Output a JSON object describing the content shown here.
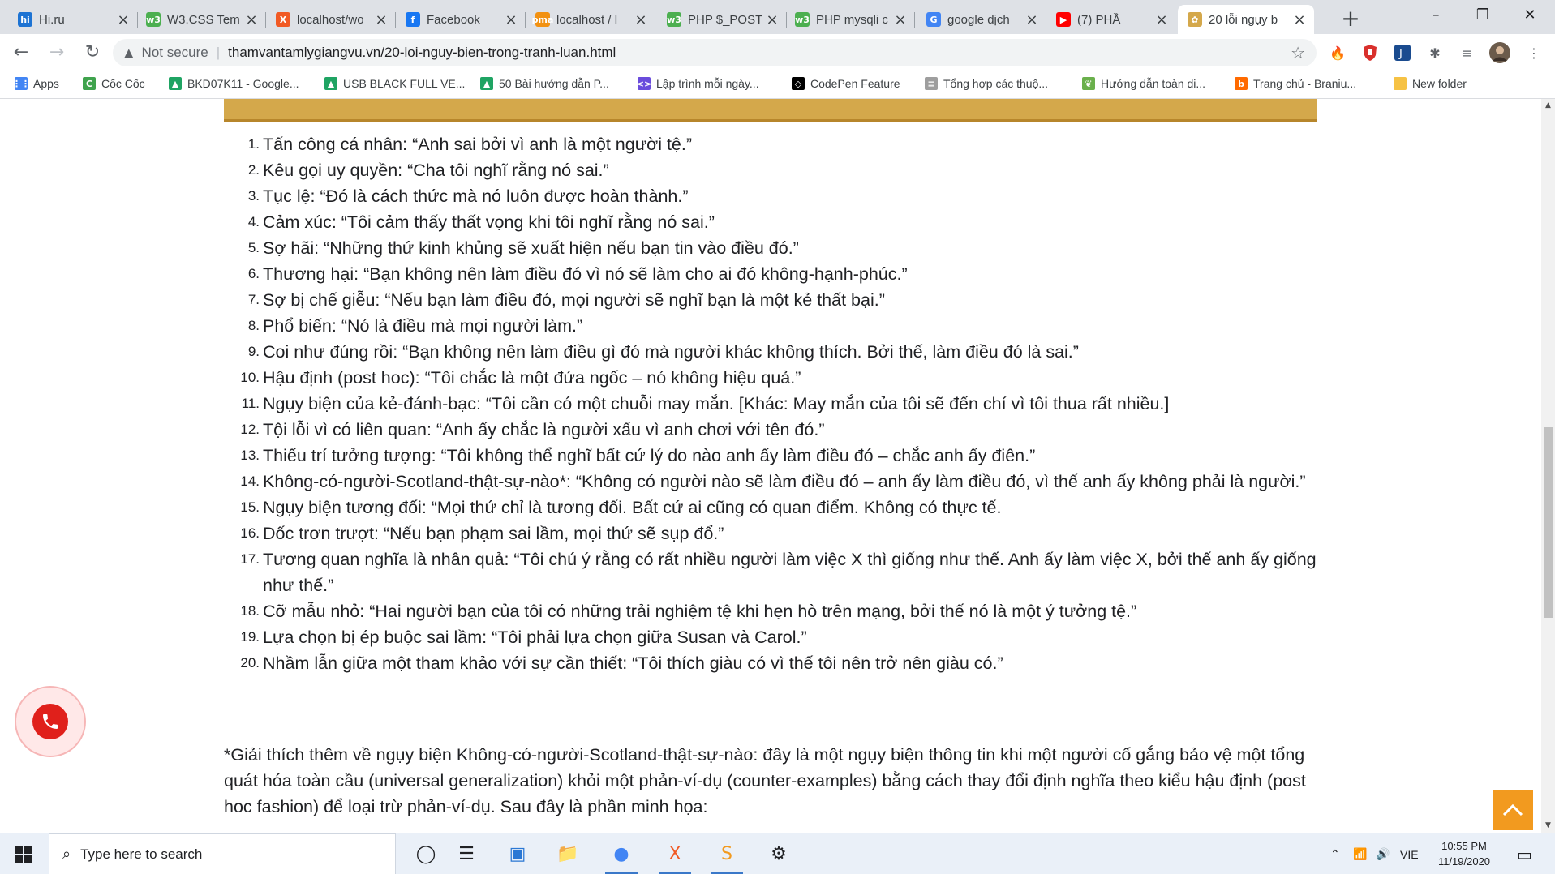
{
  "browser": {
    "tabs": [
      {
        "title": "Hi.ru",
        "icon": "hi-favicon",
        "color": "#1d73d3",
        "glyph": "hi"
      },
      {
        "title": "W3.CSS Tem",
        "icon": "w3schools-favicon",
        "color": "#4caf50",
        "glyph": "w3"
      },
      {
        "title": "localhost/wo",
        "icon": "xampp-favicon",
        "color": "#f15a24",
        "glyph": "X"
      },
      {
        "title": "Facebook",
        "icon": "facebook-favicon",
        "color": "#1877f2",
        "glyph": "f"
      },
      {
        "title": "localhost / l",
        "icon": "phpmyadmin-favicon",
        "color": "#f29111",
        "glyph": "pma"
      },
      {
        "title": "PHP $_POST",
        "icon": "w3schools-favicon",
        "color": "#4caf50",
        "glyph": "w3"
      },
      {
        "title": "PHP mysqli c",
        "icon": "w3schools-favicon",
        "color": "#4caf50",
        "glyph": "w3"
      },
      {
        "title": "google dịch",
        "icon": "google-favicon",
        "color": "#4285f4",
        "glyph": "G"
      },
      {
        "title": "(7) PHẦ",
        "icon": "youtube-favicon",
        "color": "#ff0000",
        "glyph": "▶"
      },
      {
        "title": "20 lỗi ngụy b",
        "icon": "site-favicon",
        "color": "#d4a84b",
        "glyph": "✿"
      }
    ],
    "active_tab": 9,
    "address": {
      "security_label": "Not secure",
      "url": "thamvantamlygiangvu.vn/20-loi-nguy-bien-trong-tranh-luan.html"
    },
    "bookmarks": [
      {
        "label": "Apps",
        "icon": "apps-grid-icon",
        "color": "#4285f4",
        "glyph": "⋮⋮"
      },
      {
        "label": "Cốc Cốc",
        "icon": "coccoc-icon",
        "color": "#3fa34d",
        "glyph": "C"
      },
      {
        "label": "BKD07K11 - Google...",
        "icon": "google-drive-icon",
        "color": "#1fa463",
        "glyph": "▲"
      },
      {
        "label": "USB BLACK FULL VE...",
        "icon": "google-drive-icon",
        "color": "#1fa463",
        "glyph": "▲"
      },
      {
        "label": "50 Bài hướng dẫn P...",
        "icon": "google-drive-icon",
        "color": "#1fa463",
        "glyph": "▲"
      },
      {
        "label": "Lập trình mỗi ngày...",
        "icon": "purple-site-icon",
        "color": "#6a4cdc",
        "glyph": "<>"
      },
      {
        "label": "CodePen Feature",
        "icon": "codepen-icon",
        "color": "#000000",
        "glyph": "◇"
      },
      {
        "label": "Tổng hợp các thuộ...",
        "icon": "doc-icon",
        "color": "#9e9e9e",
        "glyph": "≡"
      },
      {
        "label": "Hướng dẫn toàn di...",
        "icon": "leaf-icon",
        "color": "#6ab04c",
        "glyph": "❦"
      },
      {
        "label": "Trang chủ - Braniu...",
        "icon": "b-site-icon",
        "color": "#ff6a00",
        "glyph": "b"
      },
      {
        "label": "New folder",
        "icon": "folder-icon",
        "color": "#f6c244",
        "glyph": ""
      }
    ]
  },
  "page": {
    "fallacies": [
      {
        "num": "1.",
        "text": "Tấn công cá nhân: “Anh sai bởi vì anh là một người tệ.”"
      },
      {
        "num": "2.",
        "text": "Kêu gọi uy quyền: “Cha tôi nghĩ rằng nó sai.”"
      },
      {
        "num": "3.",
        "text": "Tục lệ: “Đó là cách thức mà nó luôn được hoàn thành.”"
      },
      {
        "num": "4.",
        "text": "Cảm xúc: “Tôi cảm thấy thất vọng khi tôi nghĩ rằng nó sai.”"
      },
      {
        "num": "5.",
        "text": "Sợ hãi: “Những thứ kinh khủng sẽ xuất hiện nếu bạn tin vào điều đó.”"
      },
      {
        "num": "6.",
        "text": "Thương hại: “Bạn không nên làm điều đó vì nó sẽ làm cho ai đó không-hạnh-phúc.”"
      },
      {
        "num": "7.",
        "text": "Sợ bị chế giễu: “Nếu bạn làm điều đó, mọi người sẽ nghĩ bạn là một kẻ thất bại.”"
      },
      {
        "num": "8.",
        "text": "Phổ biến: “Nó là điều mà mọi người làm.”"
      },
      {
        "num": "9.",
        "text": "Coi như đúng rồi: “Bạn không nên làm điều gì đó mà người khác không thích. Bởi thế, làm điều đó là sai.”"
      },
      {
        "num": "10.",
        "text": "Hậu định (post hoc): “Tôi chắc là một đứa ngốc – nó không hiệu quả.”"
      },
      {
        "num": "11.",
        "text": "Ngụy biện của kẻ-đánh-bạc: “Tôi cần có một chuỗi may mắn. [Khác: May mắn của tôi sẽ đến chí vì tôi thua rất nhiều.]"
      },
      {
        "num": "12.",
        "text": "Tội lỗi vì có liên quan: “Anh ấy chắc là người xấu vì anh chơi với tên đó.”"
      },
      {
        "num": "13.",
        "text": "Thiếu trí tưởng tượng: “Tôi không thể nghĩ bất cứ lý do nào anh ấy làm điều đó – chắc anh ấy điên.”"
      },
      {
        "num": "14.",
        "text": "Không-có-người-Scotland-thật-sự-nào*: “Không có người nào sẽ làm điều đó – anh ấy làm điều đó, vì thế anh ấy không phải là người.”"
      },
      {
        "num": "15.",
        "text": "Ngụy biện tương đối: “Mọi thứ chỉ là tương đối. Bất cứ ai cũng có quan điểm. Không có thực tế."
      },
      {
        "num": "16.",
        "text": "Dốc trơn trượt: “Nếu bạn phạm sai lầm, mọi thứ sẽ sụp đổ.”"
      },
      {
        "num": "17.",
        "text": "Tương quan nghĩa là nhân quả: “Tôi chú ý rằng có rất nhiều người làm việc X thì giống như thế. Anh ấy làm việc X, bởi thế anh ấy giống như thế.”"
      },
      {
        "num": "18.",
        "text": "Cỡ mẫu nhỏ: “Hai người bạn của tôi có những trải nghiệm tệ khi hẹn hò trên mạng, bởi thế nó là một ý tưởng tệ.”"
      },
      {
        "num": "19.",
        "text": "Lựa chọn bị ép buộc sai lầm: “Tôi phải lựa chọn giữa Susan và Carol.”"
      },
      {
        "num": "20.",
        "text": "Nhầm lẫn giữa một tham khảo với sự cần thiết: “Tôi thích giàu có vì thế tôi nên trở nên giàu có.”"
      }
    ],
    "note": "*Giải thích thêm về ngụy biện Không-có-người-Scotland-thật-sự-nào: đây là một ngụy biện thông tin khi một người cố gắng bảo vệ một tổng quát hóa toàn cầu (universal generalization) khỏi một phản-ví-dụ (counter-examples) bằng cách thay đổi định nghĩa theo kiểu hậu định (post hoc fashion) để loại trừ phản-ví-dụ. Sau đây là phần minh họa:",
    "accent_color": "#d4a84b",
    "back_to_top_color": "#f29a1f",
    "phone_color": "#e0201b"
  },
  "taskbar": {
    "search_placeholder": "Type here to search",
    "apps": [
      {
        "name": "task-view-icon",
        "glyph": "◯"
      },
      {
        "name": "task-list-icon",
        "glyph": "☰"
      },
      {
        "name": "network-app-icon",
        "glyph": "▣"
      },
      {
        "name": "file-explorer-icon",
        "glyph": "📁"
      },
      {
        "name": "chrome-icon",
        "glyph": "●"
      },
      {
        "name": "xampp-icon",
        "glyph": "X"
      },
      {
        "name": "sublime-text-icon",
        "glyph": "S"
      },
      {
        "name": "settings-gear-icon",
        "glyph": "⚙"
      }
    ],
    "lang": "VIE",
    "time": "10:55 PM",
    "date": "11/19/2020"
  }
}
